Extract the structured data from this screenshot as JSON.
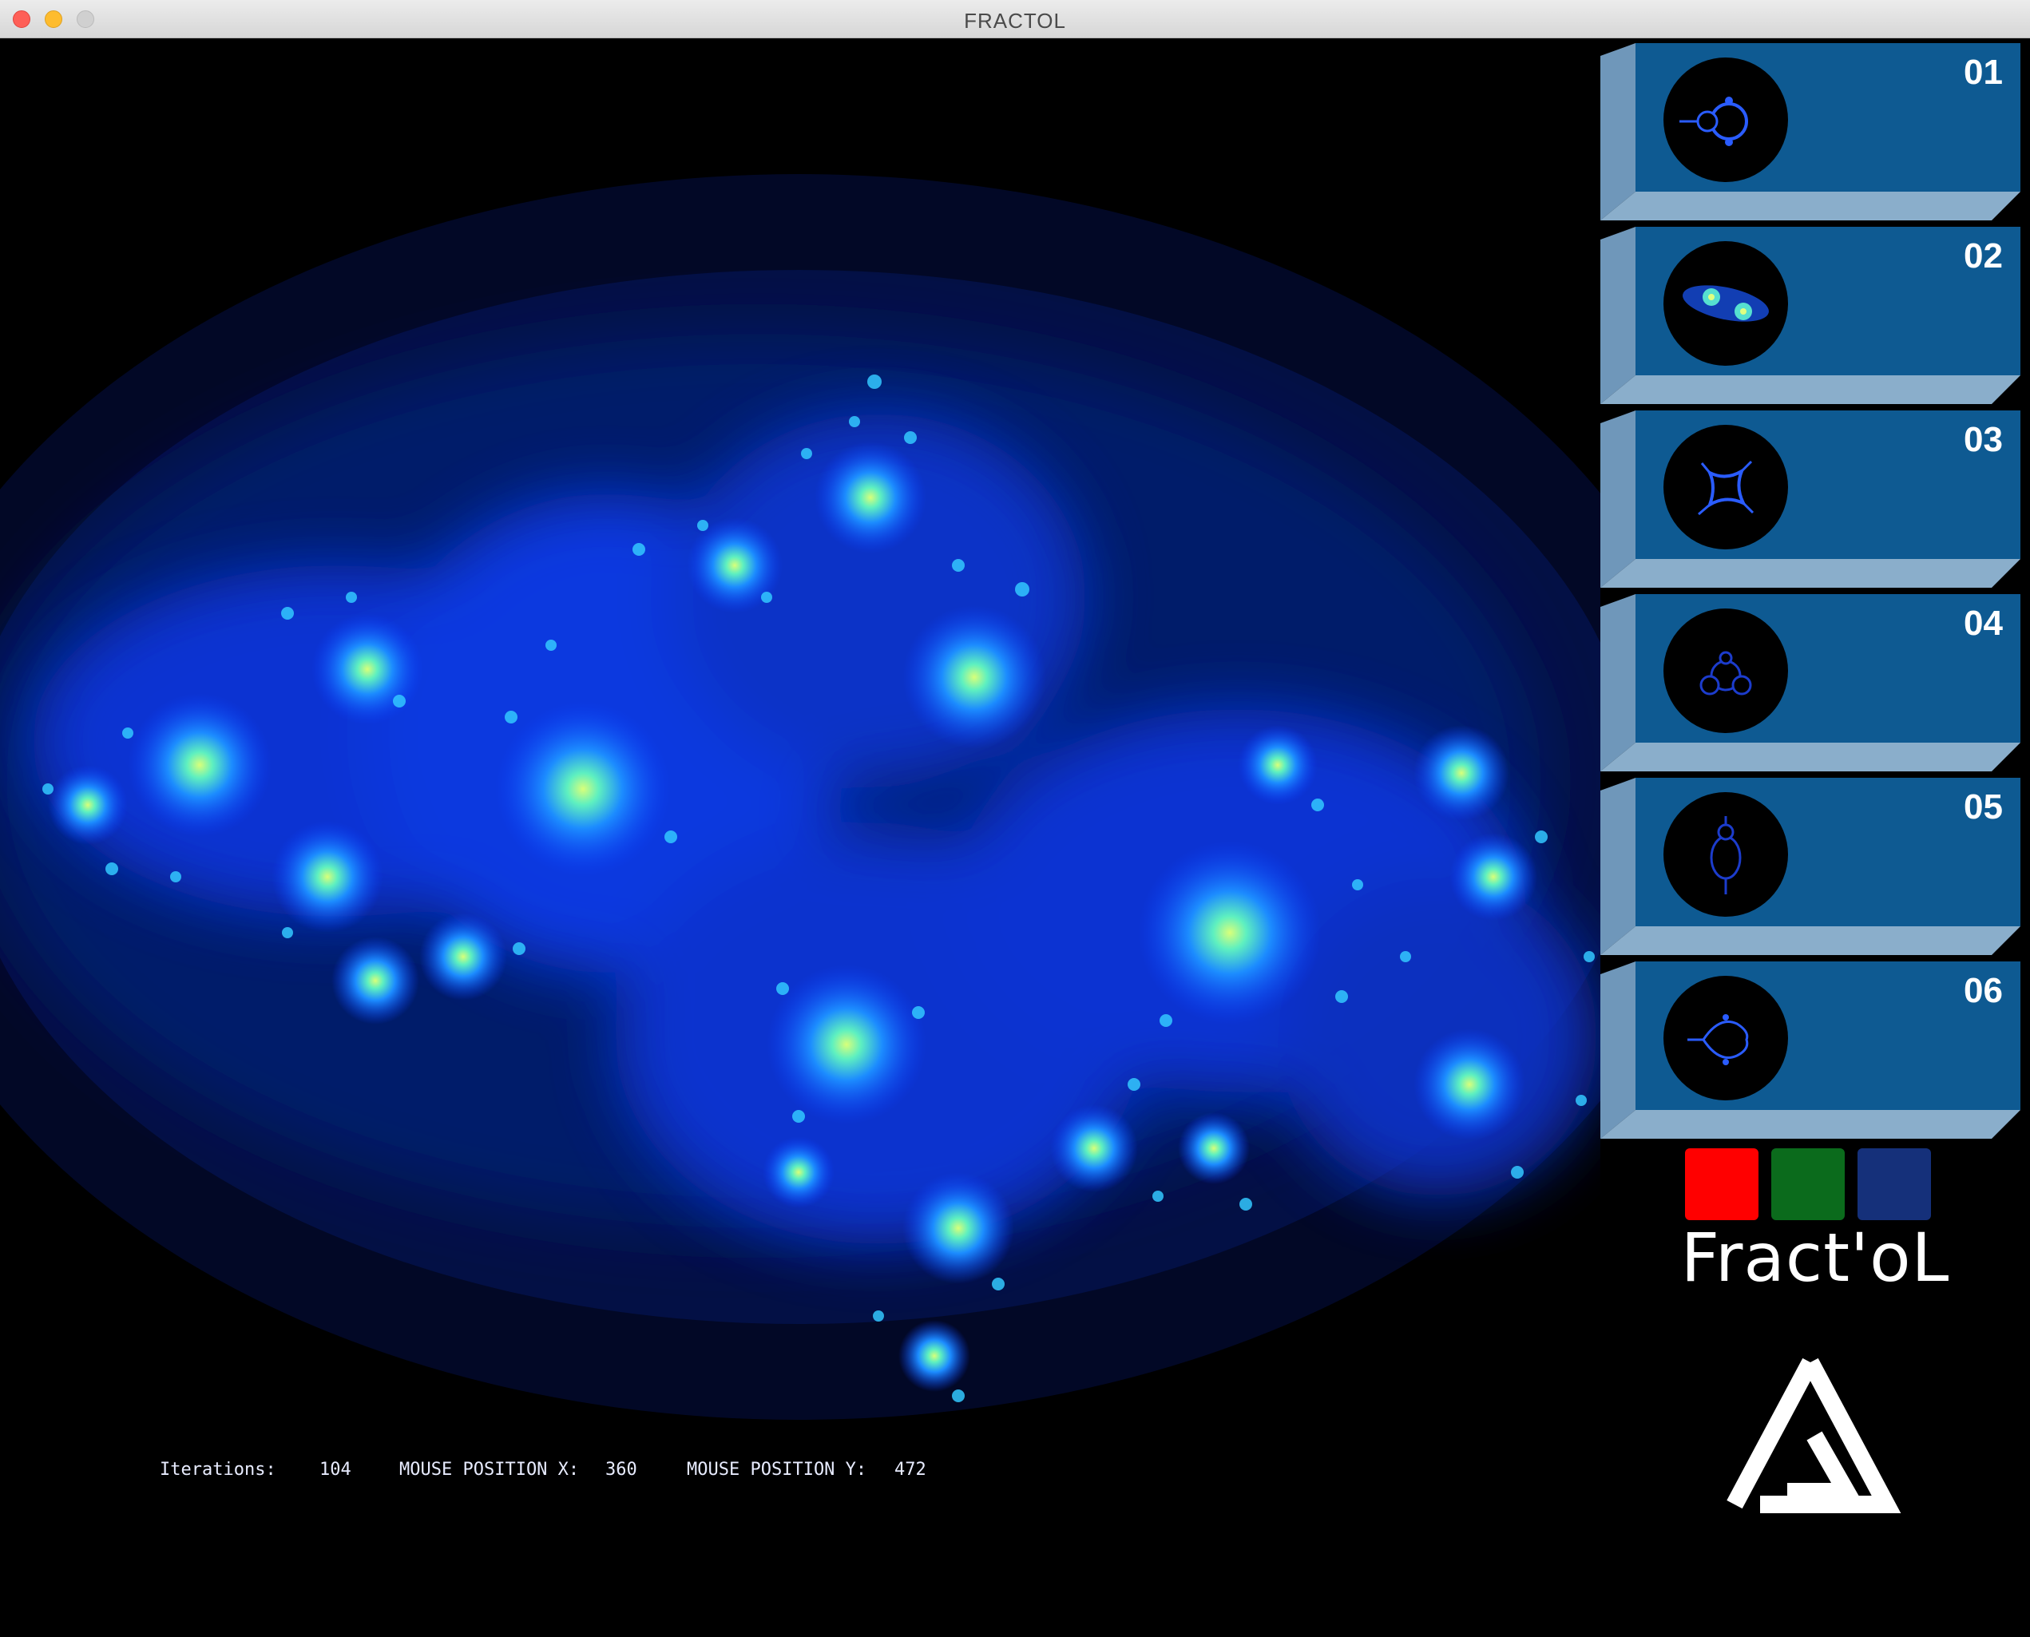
{
  "window": {
    "title": "FRACTOL"
  },
  "status": {
    "iterations_label": "Iterations:",
    "iterations_value": "104",
    "mouse_x_label": "MOUSE POSITION X:",
    "mouse_x_value": "360",
    "mouse_y_label": "MOUSE POSITION Y:",
    "mouse_y_value": "472"
  },
  "fractal_cards": [
    {
      "number": "01",
      "icon": "mandelbrot-icon"
    },
    {
      "number": "02",
      "icon": "julia-icon"
    },
    {
      "number": "03",
      "icon": "burning-ship-icon"
    },
    {
      "number": "04",
      "icon": "tricorn-icon"
    },
    {
      "number": "05",
      "icon": "mandelbar-icon"
    },
    {
      "number": "06",
      "icon": "celtic-icon"
    }
  ],
  "color_swatches": [
    {
      "name": "red",
      "color": "#ff0000"
    },
    {
      "name": "green",
      "color": "#0b6b1c"
    },
    {
      "name": "blue",
      "color": "#15307a"
    }
  ],
  "app_logo": "Fract'oL",
  "colors": {
    "panel_face": "#0e5a92",
    "fractal_glow": "#39d6ff"
  }
}
